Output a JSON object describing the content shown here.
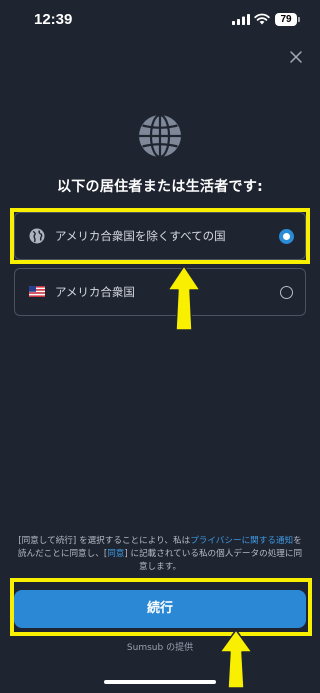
{
  "status_bar": {
    "time": "12:39",
    "battery": "79"
  },
  "heading": "以下の居住者または生活者です:",
  "options": [
    {
      "label": "アメリカ合衆国を除くすべての国",
      "icon": "globe-icon",
      "selected": true
    },
    {
      "label": "アメリカ合衆国",
      "icon": "us-flag-icon",
      "selected": false
    }
  ],
  "consent": {
    "part1": "[同意して続行] を選択することにより、私は",
    "link1": "プライバシーに関する通知",
    "part2": "を読んだことに同意し、[",
    "link2": "同意",
    "part3": "] に記載されている私の個人データの処理に同意します。"
  },
  "continue_label": "続行",
  "powered_by": "Sumsub の提供",
  "colors": {
    "background": "#1f2431",
    "accent": "#2b88d4",
    "highlight": "#f8f000"
  }
}
